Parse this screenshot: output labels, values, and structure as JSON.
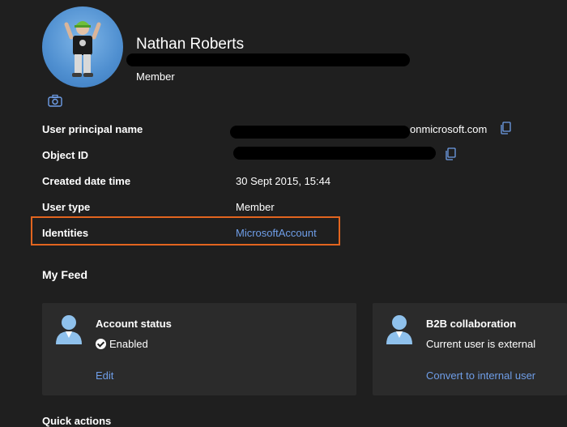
{
  "profile": {
    "name": "Nathan Roberts",
    "role": "Member"
  },
  "properties": {
    "upn": {
      "label": "User principal name",
      "value_suffix": "onmicrosoft.com"
    },
    "object_id": {
      "label": "Object ID"
    },
    "created": {
      "label": "Created date time",
      "value": "30 Sept 2015, 15:44"
    },
    "user_type": {
      "label": "User type",
      "value": "Member"
    },
    "identities": {
      "label": "Identities",
      "value": "MicrosoftAccount"
    }
  },
  "feed": {
    "title": "My Feed",
    "account_status": {
      "title": "Account status",
      "status": "Enabled",
      "action": "Edit"
    },
    "b2b": {
      "title": "B2B collaboration",
      "text": "Current user is external",
      "action": "Convert to internal user"
    }
  },
  "next_section": {
    "title": "Quick actions"
  },
  "colors": {
    "background": "#1f1f1f",
    "card": "#2b2b2b",
    "link": "#6f9ee8",
    "highlight": "#e2651f"
  }
}
